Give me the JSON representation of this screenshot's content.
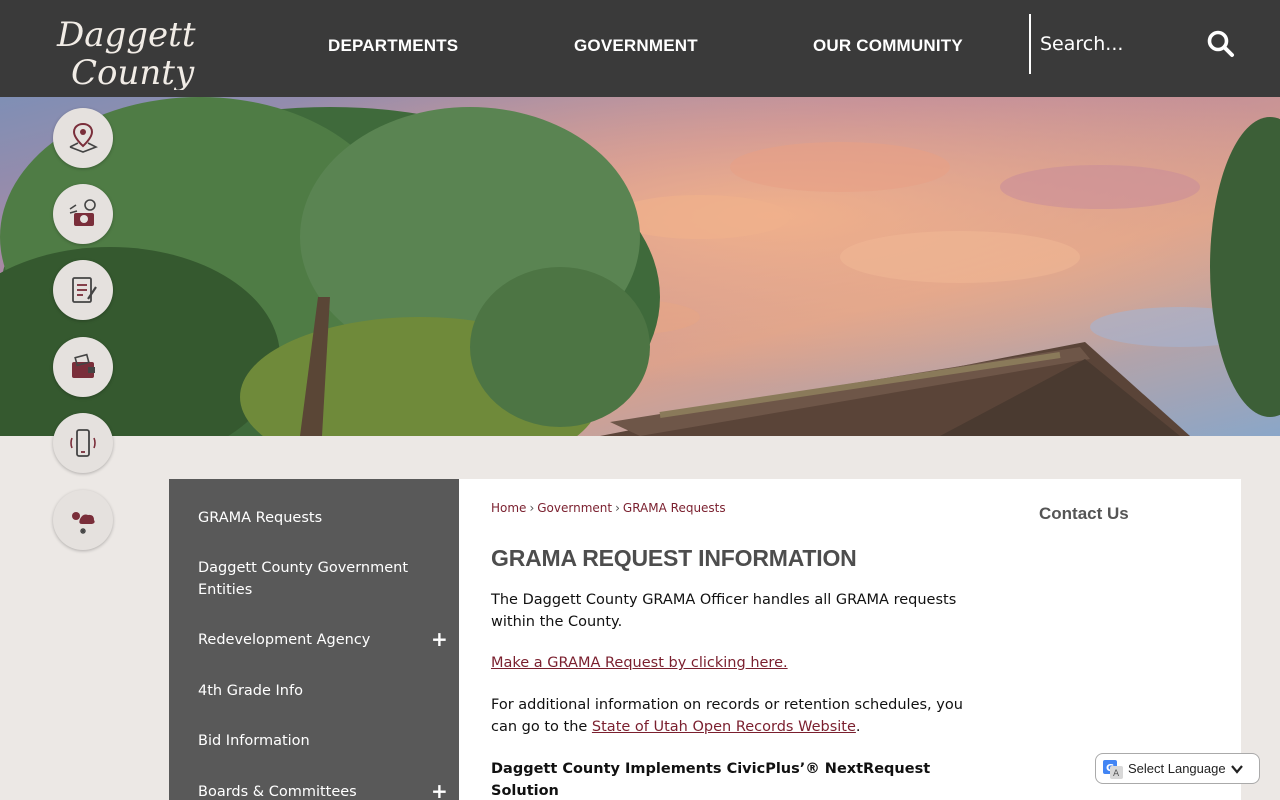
{
  "header": {
    "logo_line1": "Daggett",
    "logo_line2": "County",
    "nav": [
      "DEPARTMENTS",
      "GOVERNMENT",
      "OUR COMMUNITY"
    ],
    "search_placeholder": "Search..."
  },
  "quick_links": [
    "map-pin-icon",
    "tourism-camera-icon",
    "permit-document-icon",
    "wallet-icon",
    "mobile-phone-icon",
    "weather-icon"
  ],
  "sidebar": {
    "items": [
      {
        "label": "GRAMA Requests",
        "expandable": false
      },
      {
        "label": "Daggett County Government Entities",
        "expandable": false
      },
      {
        "label": "Redevelopment Agency",
        "expandable": true
      },
      {
        "label": "4th Grade Info",
        "expandable": false
      },
      {
        "label": "Bid Information",
        "expandable": false
      },
      {
        "label": "Boards & Committees",
        "expandable": true
      }
    ],
    "expand_symbol": "+"
  },
  "breadcrumb": [
    "Home",
    "Government",
    "GRAMA Requests"
  ],
  "breadcrumb_sep": "›",
  "main": {
    "title": "GRAMA REQUEST INFORMATION",
    "para1": "The Daggett County GRAMA Officer handles all GRAMA requests within the County.",
    "link1": "Make a GRAMA Request by clicking here.",
    "para2_prefix": "For additional information on records or retention schedules, you can go to the ",
    "para2_link": "State of Utah Open Records Website",
    "para2_suffix": ".",
    "bold_heading": "Daggett County Implements CivicPlus’® NextRequest Solution"
  },
  "right_column": {
    "contact": "Contact Us"
  },
  "translate": {
    "label": "Select Language"
  },
  "colors": {
    "header_bg": "#3a3a3a",
    "sidebar_bg": "#595959",
    "link": "#7a1f2e",
    "page_bg": "#ece8e5",
    "icon_accent": "#7a2e3a"
  }
}
